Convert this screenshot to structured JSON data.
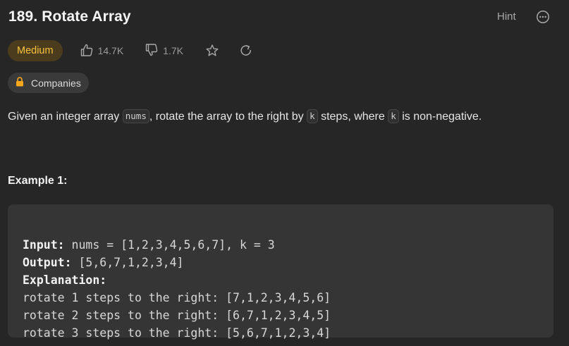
{
  "problem": {
    "title": "189. Rotate Array",
    "hint_label": "Hint",
    "difficulty": "Medium",
    "likes": "14.7K",
    "dislikes": "1.7K",
    "companies_label": "Companies"
  },
  "description": {
    "part1": "Given an integer array ",
    "code1": "nums",
    "part2": ", rotate the array to the right by ",
    "code2": "k",
    "part3": " steps, where ",
    "code3": "k",
    "part4": " is non-negative."
  },
  "example": {
    "title": "Example 1:",
    "input_label": "Input:",
    "input_value": " nums = [1,2,3,4,5,6,7], k = 3",
    "output_label": "Output:",
    "output_value": " [5,6,7,1,2,3,4]",
    "explanation_label": "Explanation:",
    "explanation_lines": [
      "rotate 1 steps to the right: [7,1,2,3,4,5,6]",
      "rotate 2 steps to the right: [6,7,1,2,3,4,5]",
      "rotate 3 steps to the right: [5,6,7,1,2,3,4]"
    ]
  },
  "icons": {
    "like": "thumbs-up-icon",
    "dislike": "thumbs-down-icon",
    "star": "star-icon",
    "share": "share-icon",
    "more": "more-options-icon",
    "lock": "lock-icon"
  },
  "colors": {
    "background": "#262626",
    "difficulty_text": "#f8c23c",
    "difficulty_bg": "#4a3c1c",
    "lock": "#f8a81c"
  }
}
